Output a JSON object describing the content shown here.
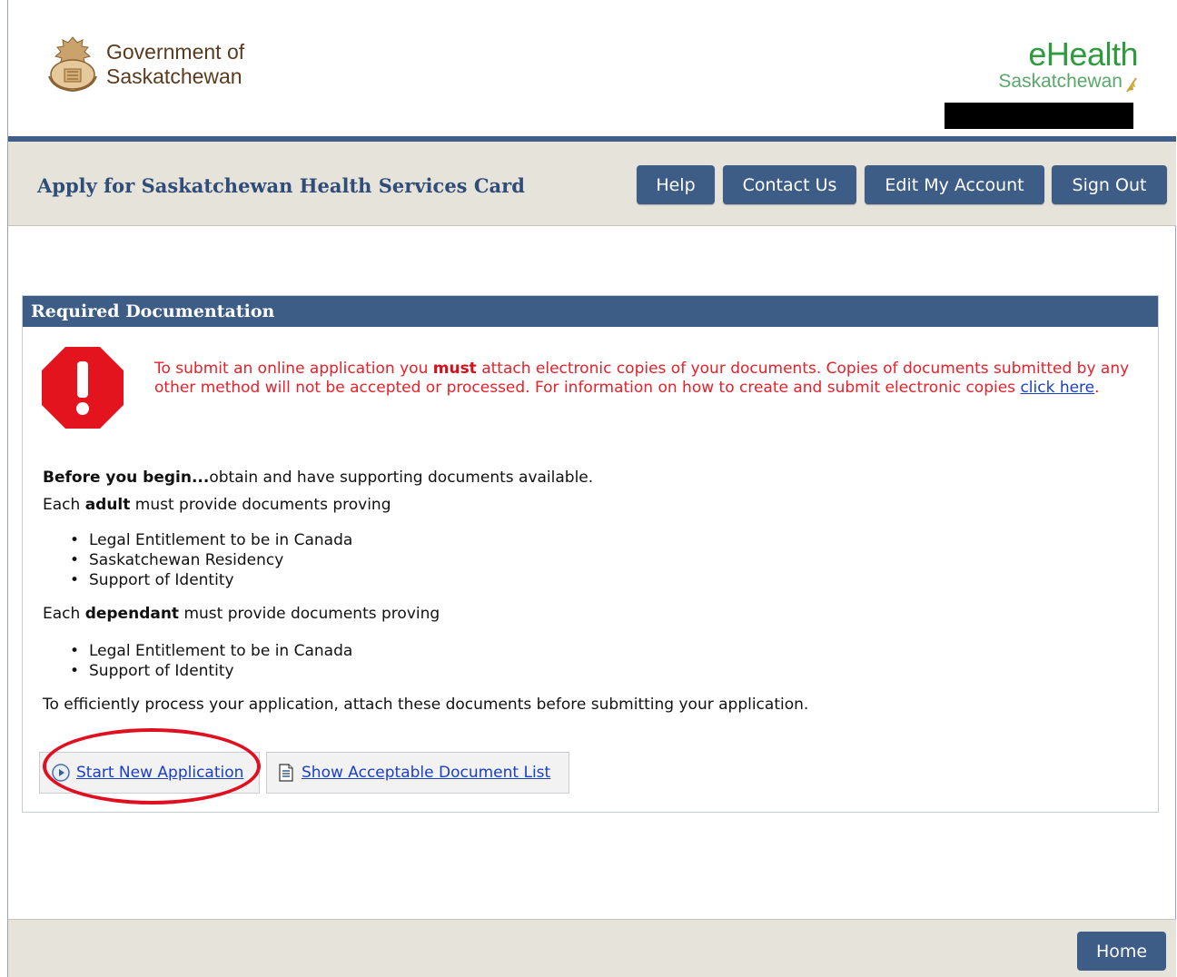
{
  "header": {
    "gov_logo_line1": "Government of",
    "gov_logo_line2": "Saskatchewan",
    "ehealth_title": "eHealth",
    "ehealth_sub": "Saskatchewan"
  },
  "titlebar": {
    "app_title": "Apply for Saskatchewan Health Services Card",
    "buttons": {
      "help": "Help",
      "contact": "Contact Us",
      "edit_account": "Edit My Account",
      "sign_out": "Sign Out"
    }
  },
  "panel": {
    "title": "Required Documentation",
    "warning": {
      "part1": "To submit an online application you ",
      "must": "must",
      "part2": " attach electronic copies of your documents. Copies of documents submitted by any other method will not be accepted or processed. For information on how to create and submit electronic copies ",
      "link": "click here",
      "part3": "."
    },
    "before_bold": "Before you begin...",
    "before_rest": "obtain and have supporting documents available.",
    "adult_pre": "Each ",
    "adult_bold": "adult",
    "adult_post": " must provide documents proving",
    "adult_items": [
      "Legal Entitlement to be in Canada",
      "Saskatchewan Residency",
      "Support of Identity"
    ],
    "dep_pre": "Each ",
    "dep_bold": "dependant",
    "dep_post": " must provide documents proving",
    "dep_items": [
      "Legal Entitlement to be in Canada",
      "Support of Identity"
    ],
    "efficient": "To efficiently process your application, attach these documents before submitting your application.",
    "start_new": "Start New Application",
    "show_list": "Show Acceptable Document List"
  },
  "footer": {
    "home": "Home"
  },
  "icons": {
    "stop": "stop-warning-icon",
    "start": "play-circle-icon",
    "list": "document-icon"
  },
  "colors": {
    "brand_blue": "#3d5d86",
    "warning_red": "#e8202a",
    "beige": "#e6e3da",
    "ehealth_green": "#2f9b3e"
  }
}
